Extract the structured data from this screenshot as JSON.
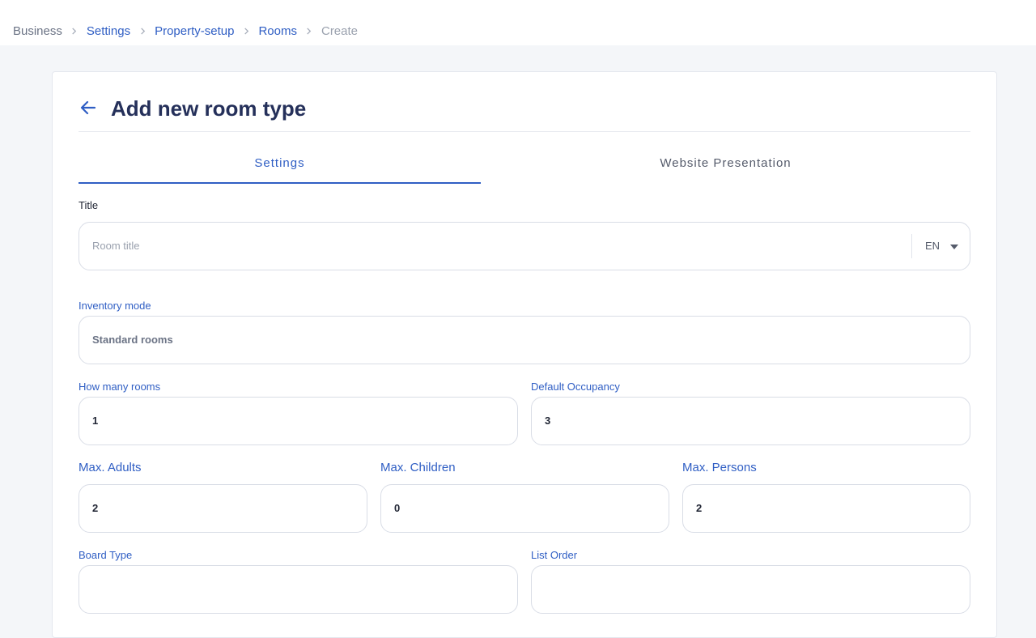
{
  "breadcrumb": [
    {
      "label": "Business"
    },
    {
      "label": "Settings"
    },
    {
      "label": "Property-setup"
    },
    {
      "label": "Rooms"
    },
    {
      "label": "Create"
    }
  ],
  "header": {
    "title": "Add new room type",
    "back_icon": "arrow-left-icon"
  },
  "tabs": [
    {
      "label": "Settings",
      "active": true
    },
    {
      "label": "Website Presentation",
      "active": false
    }
  ],
  "form": {
    "title": {
      "label": "Title",
      "placeholder": "Room title",
      "language": "EN"
    },
    "inventory_mode": {
      "label": "Inventory mode",
      "value": "Standard rooms"
    },
    "how_many_rooms": {
      "label": "How many rooms",
      "value": "1"
    },
    "default_occupancy": {
      "label": "Default Occupancy",
      "value": "3"
    },
    "max_adults": {
      "label": "Max. Adults",
      "value": "2"
    },
    "max_children": {
      "label": "Max. Children",
      "value": "0"
    },
    "max_persons": {
      "label": "Max. Persons",
      "value": "2"
    },
    "board_type": {
      "label": "Board Type"
    },
    "list_order": {
      "label": "List Order"
    }
  },
  "colors": {
    "accent": "#2f5ec4",
    "title": "#25305a",
    "background": "#f4f6f9"
  }
}
